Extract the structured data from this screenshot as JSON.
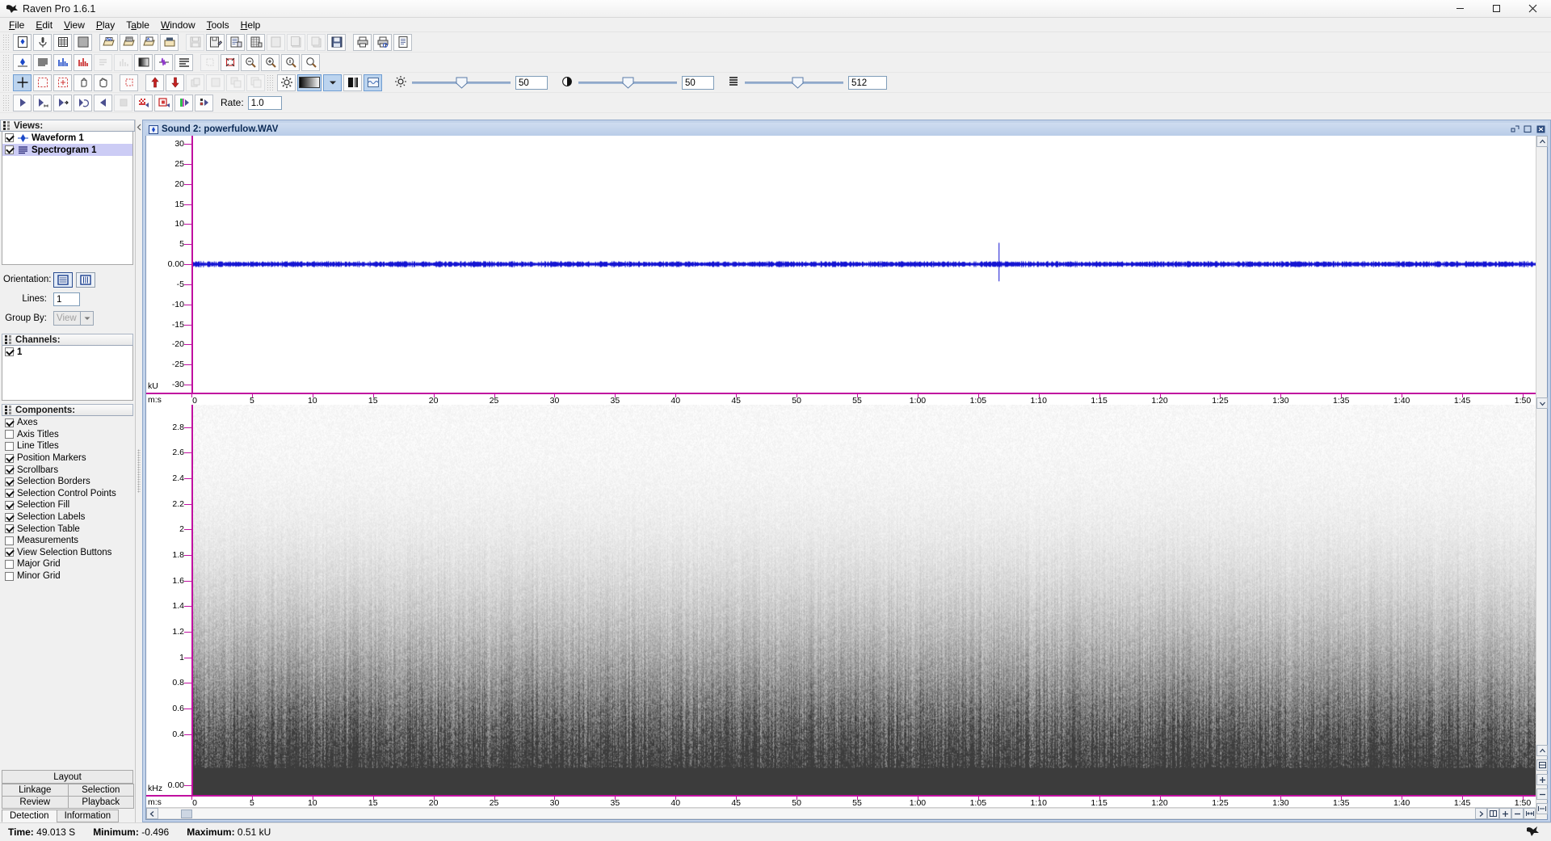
{
  "window": {
    "title": "Raven Pro 1.6.1",
    "app_icon": "raven-bird-icon",
    "minimize": "—",
    "maximize": "▢",
    "close": "✕"
  },
  "menubar": {
    "items": [
      {
        "label": "File",
        "mnemonic": "F"
      },
      {
        "label": "Edit",
        "mnemonic": "E"
      },
      {
        "label": "View",
        "mnemonic": "V"
      },
      {
        "label": "Play",
        "mnemonic": "P"
      },
      {
        "label": "Table",
        "mnemonic": "a"
      },
      {
        "label": "Window",
        "mnemonic": "W"
      },
      {
        "label": "Tools",
        "mnemonic": "T"
      },
      {
        "label": "Help",
        "mnemonic": "H"
      }
    ]
  },
  "toolbars": {
    "row1": [
      {
        "name": "new-sound-window",
        "icon": "file-blue-diamond-icon",
        "enabled": true
      },
      {
        "name": "record-new-sound",
        "icon": "microphone-icon",
        "enabled": true
      },
      {
        "name": "new-selection-table",
        "icon": "table-grid-icon",
        "enabled": true
      },
      {
        "name": "new-sound-table",
        "icon": "grid-dense-icon",
        "enabled": true
      },
      {
        "name": "open-sound-file",
        "icon": "open-folder-waveform-icon",
        "enabled": true
      },
      {
        "name": "open-selection-table",
        "icon": "open-folder-table-icon",
        "enabled": true
      },
      {
        "name": "open-sound-table",
        "icon": "open-folder-list-icon",
        "enabled": true
      },
      {
        "name": "open-workspace",
        "icon": "open-box-icon",
        "enabled": true
      },
      {
        "name": "save-sound",
        "icon": "floppy-icon",
        "enabled": false
      },
      {
        "name": "save-sound-as",
        "icon": "floppy-pen-icon",
        "enabled": true
      },
      {
        "name": "save-selection-table",
        "icon": "floppy-doc-icon",
        "enabled": true
      },
      {
        "name": "save-sound-table",
        "icon": "floppy-grid-icon",
        "enabled": true
      },
      {
        "name": "save-all-1",
        "icon": "floppy-stack-icon",
        "enabled": false
      },
      {
        "name": "save-all-2",
        "icon": "floppy-copy-icon",
        "enabled": false
      },
      {
        "name": "save-all-3",
        "icon": "floppy-multi-icon",
        "enabled": false
      },
      {
        "name": "save-workspace",
        "icon": "floppy-blue-icon",
        "enabled": true
      },
      {
        "name": "print",
        "icon": "printer-icon",
        "enabled": true
      },
      {
        "name": "print-preview",
        "icon": "printer-preview-icon",
        "enabled": true
      },
      {
        "name": "page-setup",
        "icon": "page-setup-icon",
        "enabled": true
      }
    ],
    "row2": [
      {
        "name": "add-waveform-view",
        "icon": "waveform-diamond-icon",
        "enabled": true
      },
      {
        "name": "add-spectrogram-view",
        "icon": "spectrogram-lines-icon",
        "enabled": true
      },
      {
        "name": "add-spectrum-view",
        "icon": "spectrum-blue-bars-icon",
        "enabled": true
      },
      {
        "name": "add-selection-spectrum-view",
        "icon": "spectrum-red-bars-icon",
        "enabled": true
      },
      {
        "name": "remove-view-1",
        "icon": "remove-lines-icon",
        "enabled": false
      },
      {
        "name": "remove-view-2",
        "icon": "remove-bars-icon",
        "enabled": false
      },
      {
        "name": "color-map",
        "icon": "gradient-black-white-icon",
        "enabled": true
      },
      {
        "name": "spectrogram-slice",
        "icon": "purple-waveform-icon",
        "enabled": true
      },
      {
        "name": "view-properties",
        "icon": "list-lines-icon",
        "enabled": true
      },
      {
        "name": "zoom-to-selection",
        "icon": "zoom-box-grey-icon",
        "enabled": false
      },
      {
        "name": "zoom-all",
        "icon": "zoom-expand-red-icon",
        "enabled": true
      },
      {
        "name": "zoom-x-in",
        "icon": "magnifier-x-in-icon",
        "enabled": true
      },
      {
        "name": "zoom-x-out",
        "icon": "magnifier-x-out-icon",
        "enabled": true
      },
      {
        "name": "zoom-y-in",
        "icon": "magnifier-y-in-icon",
        "enabled": true
      },
      {
        "name": "zoom-y-out",
        "icon": "magnifier-y-out-icon",
        "enabled": true
      }
    ],
    "row3": [
      {
        "name": "crosshair-tool",
        "icon": "crosshair-icon",
        "enabled": true,
        "selected": true
      },
      {
        "name": "selection-tool",
        "icon": "dashed-square-icon",
        "enabled": true,
        "selected": false
      },
      {
        "name": "annotate-selection-tool",
        "icon": "dashed-square-plus-icon",
        "enabled": true,
        "selected": false
      },
      {
        "name": "pointer-hand-tool",
        "icon": "pointing-hand-icon",
        "enabled": true,
        "selected": false
      },
      {
        "name": "pan-hand-tool",
        "icon": "open-hand-icon",
        "enabled": true,
        "selected": false
      },
      {
        "name": "new-selection",
        "icon": "red-dashed-box-icon",
        "enabled": true
      },
      {
        "name": "move-selection-up",
        "icon": "red-arrow-up-icon",
        "enabled": true
      },
      {
        "name": "move-selection-down",
        "icon": "red-arrow-down-icon",
        "enabled": true
      },
      {
        "name": "copy-selection",
        "icon": "stack-grey-icon",
        "enabled": false
      },
      {
        "name": "paste-selection",
        "icon": "paste-grey-icon",
        "enabled": false
      },
      {
        "name": "duplicate-selection",
        "icon": "duplicate-grey-icon",
        "enabled": false
      },
      {
        "name": "group-selection",
        "icon": "group-grey-icon",
        "enabled": false
      },
      {
        "name": "spectrogram-settings",
        "icon": "gear-icon",
        "enabled": true
      },
      {
        "name": "colormap-preview",
        "icon": "gradient-swatch-icon",
        "enabled": true
      },
      {
        "name": "colormap-dropdown",
        "icon": "chevron-down-icon",
        "enabled": true
      },
      {
        "name": "contrast-mode",
        "icon": "gradient-split-icon",
        "enabled": true
      },
      {
        "name": "waveform-overlay",
        "icon": "blue-wave-box-icon",
        "enabled": true
      }
    ],
    "brightness": {
      "icon": "sun-icon",
      "value": "50",
      "percent": 50
    },
    "contrast": {
      "icon": "contrast-half-circle-icon",
      "value": "50",
      "percent": 50
    },
    "fft_size": {
      "icon": "lines-list-icon",
      "value": "512",
      "percent": 54
    },
    "row4": [
      {
        "name": "play",
        "icon": "play-icon",
        "enabled": true
      },
      {
        "name": "play-from-cursor",
        "icon": "play-cursor-icon",
        "enabled": true
      },
      {
        "name": "play-to-end",
        "icon": "play-end-icon",
        "enabled": true
      },
      {
        "name": "play-loop",
        "icon": "play-loop-icon",
        "enabled": true
      },
      {
        "name": "play-backwards",
        "icon": "play-reverse-icon",
        "enabled": true
      },
      {
        "name": "stop",
        "icon": "stop-icon",
        "enabled": false
      },
      {
        "name": "pause",
        "icon": "play-checker-icon",
        "enabled": true
      },
      {
        "name": "play-selection",
        "icon": "play-box-red-icon",
        "enabled": true
      },
      {
        "name": "play-signal",
        "icon": "play-green-bar-icon",
        "enabled": true
      },
      {
        "name": "play-all",
        "icon": "play-grid-icon",
        "enabled": true
      }
    ],
    "rate": {
      "label": "Rate:",
      "value": "1.0"
    }
  },
  "sidebar": {
    "views": {
      "header": "Views:",
      "items": [
        {
          "label": "Waveform 1",
          "checked": true,
          "selected": false,
          "icon": "waveform-diamond-icon"
        },
        {
          "label": "Spectrogram 1",
          "checked": true,
          "selected": true,
          "icon": "spectrogram-lines-icon"
        }
      ]
    },
    "options": {
      "orientation_label": "Orientation:",
      "orientation_horizontal_icon": "rows-layout-icon",
      "orientation_vertical_icon": "columns-layout-icon",
      "orientation_selected": "horizontal",
      "lines_label": "Lines:",
      "lines_value": "1",
      "group_by_label": "Group By:",
      "group_by_value": "View"
    },
    "channels": {
      "header": "Channels:",
      "items": [
        {
          "label": "1",
          "checked": true
        }
      ]
    },
    "components": {
      "header": "Components:",
      "items": [
        {
          "label": "Axes",
          "checked": true
        },
        {
          "label": "Axis Titles",
          "checked": false
        },
        {
          "label": "Line Titles",
          "checked": false
        },
        {
          "label": "Position Markers",
          "checked": true
        },
        {
          "label": "Scrollbars",
          "checked": true
        },
        {
          "label": "Selection Borders",
          "checked": true
        },
        {
          "label": "Selection Control Points",
          "checked": true
        },
        {
          "label": "Selection Fill",
          "checked": true
        },
        {
          "label": "Selection Labels",
          "checked": true
        },
        {
          "label": "Selection Table",
          "checked": true
        },
        {
          "label": "Measurements",
          "checked": false
        },
        {
          "label": "View Selection Buttons",
          "checked": true
        },
        {
          "label": "Major Grid",
          "checked": false
        },
        {
          "label": "Minor Grid",
          "checked": false
        }
      ]
    },
    "layout": {
      "header": "Layout",
      "tabs": [
        "Linkage",
        "Selection",
        "Review",
        "Playback"
      ]
    },
    "bottom_tabs": [
      {
        "label": "Detection",
        "active": true
      },
      {
        "label": "Information",
        "active": false
      }
    ]
  },
  "sound_window": {
    "title": "Sound 2: powerfulow.WAV",
    "title_icon": "sound-window-icon",
    "restore_icon": "restore-icon",
    "maximize_icon": "maximize-icon",
    "close_icon": "close-icon"
  },
  "chart_data": [
    {
      "type": "line",
      "name": "waveform-view",
      "title": "Waveform 1",
      "ylabel": "kU",
      "xlabel": "m:s",
      "ylim": [
        -30,
        30
      ],
      "yticks": [
        30,
        25,
        20,
        15,
        10,
        5,
        0,
        -5,
        -10,
        -15,
        -20,
        -25,
        -30
      ],
      "ytick_labels": [
        "30",
        "25",
        "20",
        "15",
        "10",
        "5",
        "0.00",
        "-5",
        "-10",
        "-15",
        "-20",
        "-25",
        "-30"
      ],
      "xlim_seconds": [
        0,
        113
      ],
      "xticks": [
        "0",
        "5",
        "10",
        "15",
        "20",
        "25",
        "30",
        "35",
        "40",
        "45",
        "50",
        "55",
        "1:00",
        "1:05",
        "1:10",
        "1:15",
        "1:20",
        "1:25",
        "1:30",
        "1:35",
        "1:40",
        "1:45",
        "1:50"
      ],
      "series_color": "#1414d2",
      "description": "Dense low-amplitude noise band centered at 0.00 kU with one taller transient spike near 1:08",
      "noise_amplitude_kU": 0.5,
      "spike_time": "1:08",
      "spike_amplitude_kU": 5.0
    },
    {
      "type": "heatmap",
      "name": "spectrogram-view",
      "title": "Spectrogram 1",
      "ylabel": "kHz",
      "xlabel": "m:s",
      "ylim": [
        0,
        2.9
      ],
      "yticks": [
        2.8,
        2.6,
        2.4,
        2.2,
        2.0,
        1.8,
        1.6,
        1.4,
        1.2,
        1.0,
        0.8,
        0.6,
        0.4,
        0.0
      ],
      "ytick_labels": [
        "2.8",
        "2.6",
        "2.4",
        "2.2",
        "2",
        "1.8",
        "1.6",
        "1.4",
        "1.2",
        "1",
        "0.8",
        "0.6",
        "0.4",
        "0.00"
      ],
      "xlim_seconds": [
        0,
        113
      ],
      "xticks": [
        "0",
        "5",
        "10",
        "15",
        "20",
        "25",
        "30",
        "35",
        "40",
        "45",
        "50",
        "55",
        "1:00",
        "1:05",
        "1:10",
        "1:15",
        "1:20",
        "1:25",
        "1:30",
        "1:35",
        "1:40",
        "1:45",
        "1:50"
      ],
      "colormap": "grayscale",
      "description": "Broadband vertical-streak noise, energy strongest below 0.4 kHz, fading toward 2.8 kHz"
    }
  ],
  "statusbar": {
    "time_label": "Time:",
    "time_value": "49.013 S",
    "minimum_label": "Minimum:",
    "minimum_value": "-0.496",
    "maximum_label": "Maximum:",
    "maximum_value": "0.51 kU",
    "cursor_icon": "bird-cursor-icon"
  }
}
